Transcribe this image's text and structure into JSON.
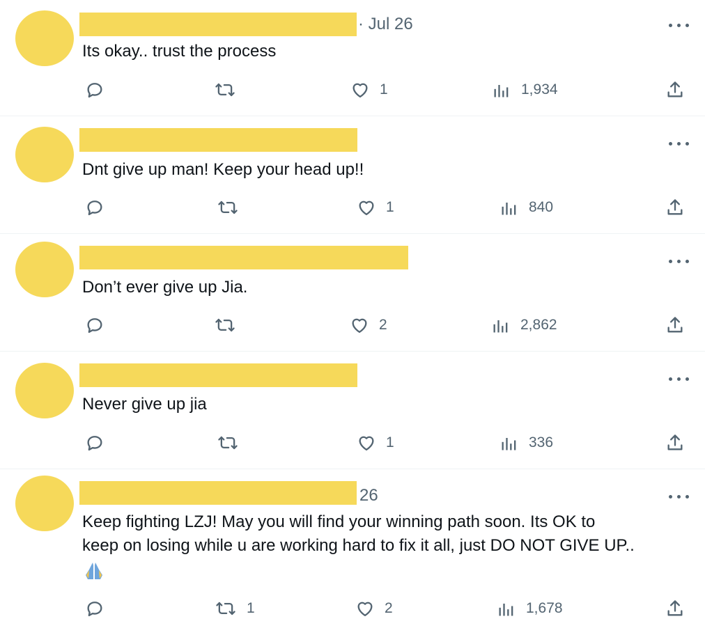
{
  "tweets": [
    {
      "time": "· Jul 26",
      "text": "Its okay.. trust the process",
      "text2": "",
      "emoji": "",
      "reply_count": "",
      "retweet_count": "",
      "like_count": "1",
      "view_count": "1,934"
    },
    {
      "time": "",
      "text": "Dnt give up man! Keep your head up!!",
      "text2": "",
      "emoji": "",
      "reply_count": "",
      "retweet_count": "",
      "like_count": "1",
      "view_count": "840"
    },
    {
      "time": "",
      "text": "Don’t ever give up Jia.",
      "text2": "",
      "emoji": "",
      "reply_count": "",
      "retweet_count": "",
      "like_count": "2",
      "view_count": "2,862"
    },
    {
      "time": "",
      "text": "Never give up jia",
      "text2": "",
      "emoji": "",
      "reply_count": "",
      "retweet_count": "",
      "like_count": "1",
      "view_count": "336"
    },
    {
      "time": "26",
      "text": "Keep fighting LZJ! May you will find your winning path soon. Its OK to",
      "text2": "keep on losing while u are working hard to fix it all, just DO NOT GIVE UP..",
      "emoji": "folded-hands",
      "reply_count": "",
      "retweet_count": "1",
      "like_count": "2",
      "view_count": "1,678"
    }
  ],
  "colors": {
    "redaction": "#f6d95a",
    "icon": "#536471",
    "text": "#0f1419",
    "divider": "#eff3f4"
  }
}
